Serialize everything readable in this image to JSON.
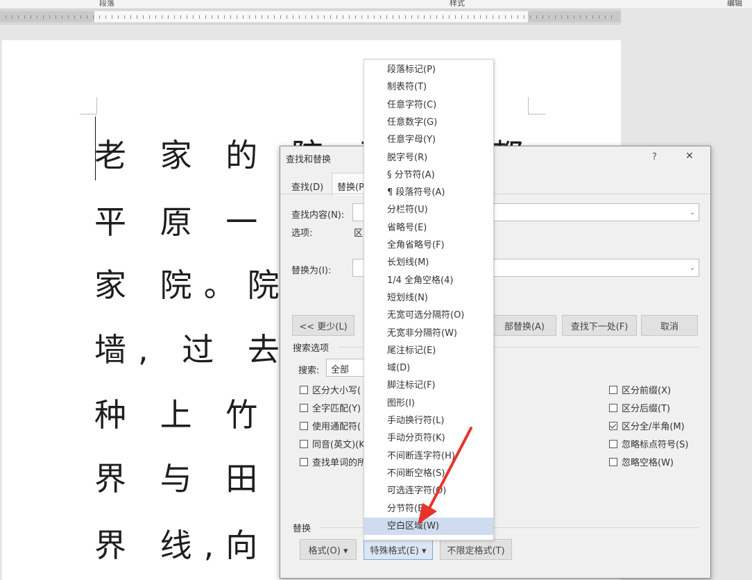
{
  "ribbon": {
    "group_paragraph": "段落",
    "group_style": "样式",
    "group_edit": "编辑"
  },
  "document": {
    "lines": [
      "老 家 的 院 子 ",
      "平 原 一 处",
      "家 院。院",
      "墙, 过 去",
      "种 上 竹 子",
      "界 与 田 埂",
      "界 线,向 内"
    ],
    "tail_text": "都"
  },
  "dialog": {
    "title": "查找和替换",
    "help": "?",
    "close": "✕",
    "tabs": [
      {
        "label": "查找(D)"
      },
      {
        "label": "替换(P)"
      }
    ],
    "find_label": "查找内容(N):",
    "options_label": "选项:",
    "options_value": "区",
    "replace_label": "替换为(I):",
    "less_button": "<< 更少(L)",
    "replace_all_button": "部替换(A)",
    "find_next_button": "查找下一处(F)",
    "cancel_button": "取消",
    "search_options_header": "搜索选项",
    "search_label": "搜索:",
    "search_value": "全部",
    "left_options": [
      {
        "label": "区分大小写(",
        "checked": false
      },
      {
        "label": "全字匹配(Y)",
        "checked": false
      },
      {
        "label": "使用通配符(",
        "checked": false
      },
      {
        "label": "同音(英文)(K",
        "checked": false
      },
      {
        "label": "查找单词的所",
        "checked": false
      }
    ],
    "right_options": [
      {
        "label": "区分前缀(X)",
        "checked": false
      },
      {
        "label": "区分后缀(T)",
        "checked": false
      },
      {
        "label": "区分全/半角(M)",
        "checked": true
      },
      {
        "label": "忽略标点符号(S)",
        "checked": false
      },
      {
        "label": "忽略空格(W)",
        "checked": false
      }
    ],
    "replace_header": "替换",
    "format_button": "格式(O) ▾",
    "special_button": "特殊格式(E) ▾",
    "no_format_button": "不限定格式(T)"
  },
  "special_menu": {
    "items": [
      "段落标记(P)",
      "制表符(T)",
      "任意字符(C)",
      "任意数字(G)",
      "任意字母(Y)",
      "脱字号(R)",
      "§ 分节符(A)",
      "¶ 段落符号(A)",
      "分栏符(U)",
      "省略号(E)",
      "全角省略号(F)",
      "长划线(M)",
      "1/4 全角空格(4)",
      "短划线(N)",
      "无宽可选分隔符(O)",
      "无宽非分隔符(W)",
      "尾注标记(E)",
      "域(D)",
      "脚注标记(F)",
      "图形(I)",
      "手动换行符(L)",
      "手动分页符(K)",
      "不间断连字符(H)",
      "不间断空格(S)",
      "可选连字符(O)",
      "分节符(B)",
      "空白区域(W)"
    ],
    "highlighted_index": 26
  },
  "colors": {
    "highlight": "#cfdcf0",
    "arrow": "#e8332a"
  }
}
